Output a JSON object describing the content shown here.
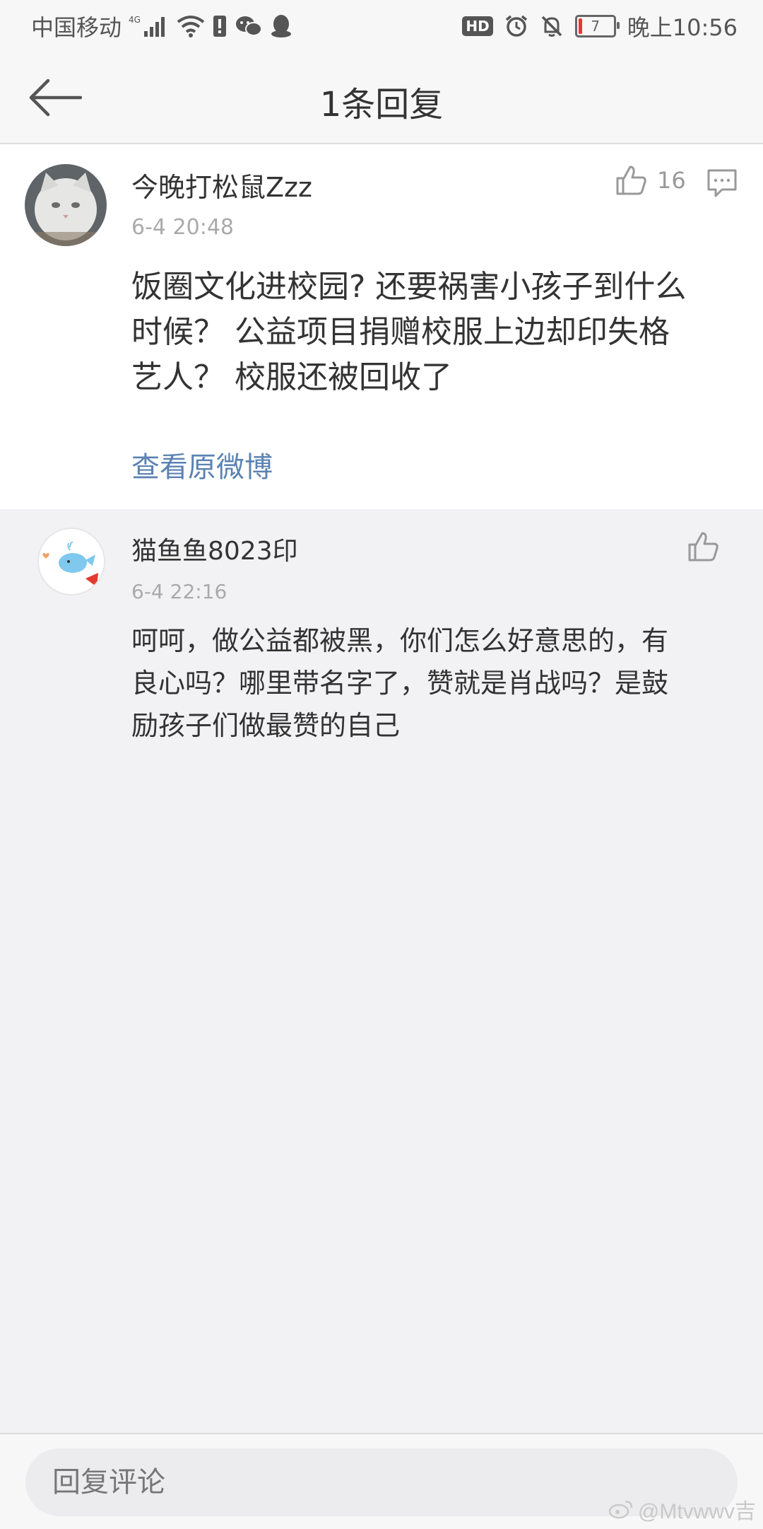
{
  "status_bar": {
    "carrier": "中国移动",
    "network": "4G",
    "hd": "HD",
    "battery_level": "7",
    "time": "晚上10:56"
  },
  "nav": {
    "title": "1条回复",
    "back_icon": "arrow-left-icon"
  },
  "comment": {
    "username": "今晚打松鼠Zzz",
    "timestamp": "6-4 20:48",
    "like_count": "16",
    "text_lines": [
      "饭圈文化进校园? 还要祸害小孩子到什么",
      "时候？ 公益项目捐赠校服上边却印失格",
      "艺人？ 校服还被回收了"
    ],
    "view_original": "查看原微博"
  },
  "reply": {
    "username": "猫鱼鱼8023印",
    "timestamp": "6-4 22:16",
    "text_lines": [
      "呵呵，做公益都被黑，你们怎么好意思的，有",
      "良心吗？哪里带名字了，赞就是肖战吗？是鼓",
      "励孩子们做最赞的自己"
    ]
  },
  "input": {
    "placeholder": "回复评论"
  },
  "watermark": {
    "text": "@Mtvwwv吉"
  },
  "colors": {
    "link": "#5b82b3",
    "background": "#f2f2f4",
    "battery_low": "#ee3333"
  }
}
